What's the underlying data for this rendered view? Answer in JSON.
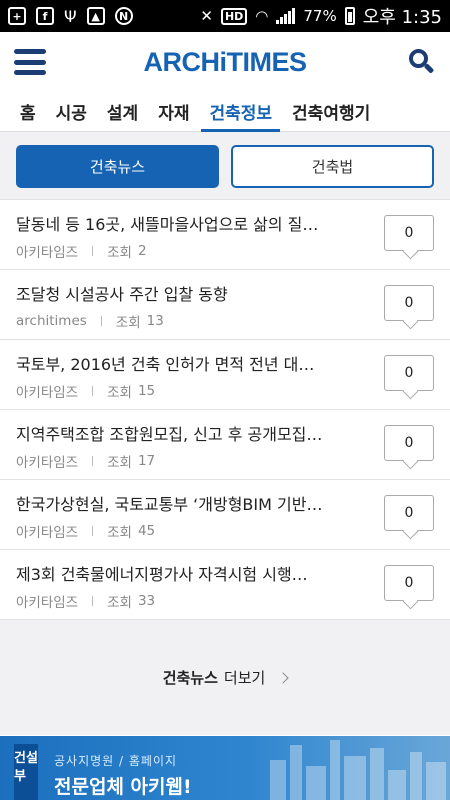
{
  "status_bar": {
    "battery": "77%",
    "time": "오후 1:35"
  },
  "header": {
    "logo": "ARCHiTIMES"
  },
  "tabs": [
    {
      "label": "홈"
    },
    {
      "label": "시공"
    },
    {
      "label": "설계"
    },
    {
      "label": "자재"
    },
    {
      "label": "건축정보",
      "active": true
    },
    {
      "label": "건축여행기"
    }
  ],
  "segments": {
    "left": "건축뉴스",
    "right": "건축법"
  },
  "list": [
    {
      "title": "달동네 등 16곳, 새뜰마을사업으로 삶의 질…",
      "author": "아키타임즈",
      "views_label": "조회",
      "views": "2",
      "comments": "0"
    },
    {
      "title": "조달청 시설공사 주간 입찰 동향",
      "author": "architimes",
      "views_label": "조회",
      "views": "13",
      "comments": "0"
    },
    {
      "title": "국토부, 2016년 건축 인허가 면적 전년 대비…",
      "author": "아키타임즈",
      "views_label": "조회",
      "views": "15",
      "comments": "0"
    },
    {
      "title": "지역주택조합 조합원모집, 신고 후 공개모집…",
      "author": "아키타임즈",
      "views_label": "조회",
      "views": "17",
      "comments": "0"
    },
    {
      "title": "한국가상현실, 국토교통부 ‘개방형BIM 기반…",
      "author": "아키타임즈",
      "views_label": "조회",
      "views": "45",
      "comments": "0"
    },
    {
      "title": "제3회 건축물에너지평가사 자격시험 시행…",
      "author": "아키타임즈",
      "views_label": "조회",
      "views": "33",
      "comments": "0"
    }
  ],
  "more": {
    "bold": "건축뉴스",
    "text": "더보기"
  },
  "banner": {
    "tag": "건설부",
    "sub": "공사지명원 / 홈페이지",
    "main_a": "전문업체",
    "main_b": "아키웹!"
  }
}
